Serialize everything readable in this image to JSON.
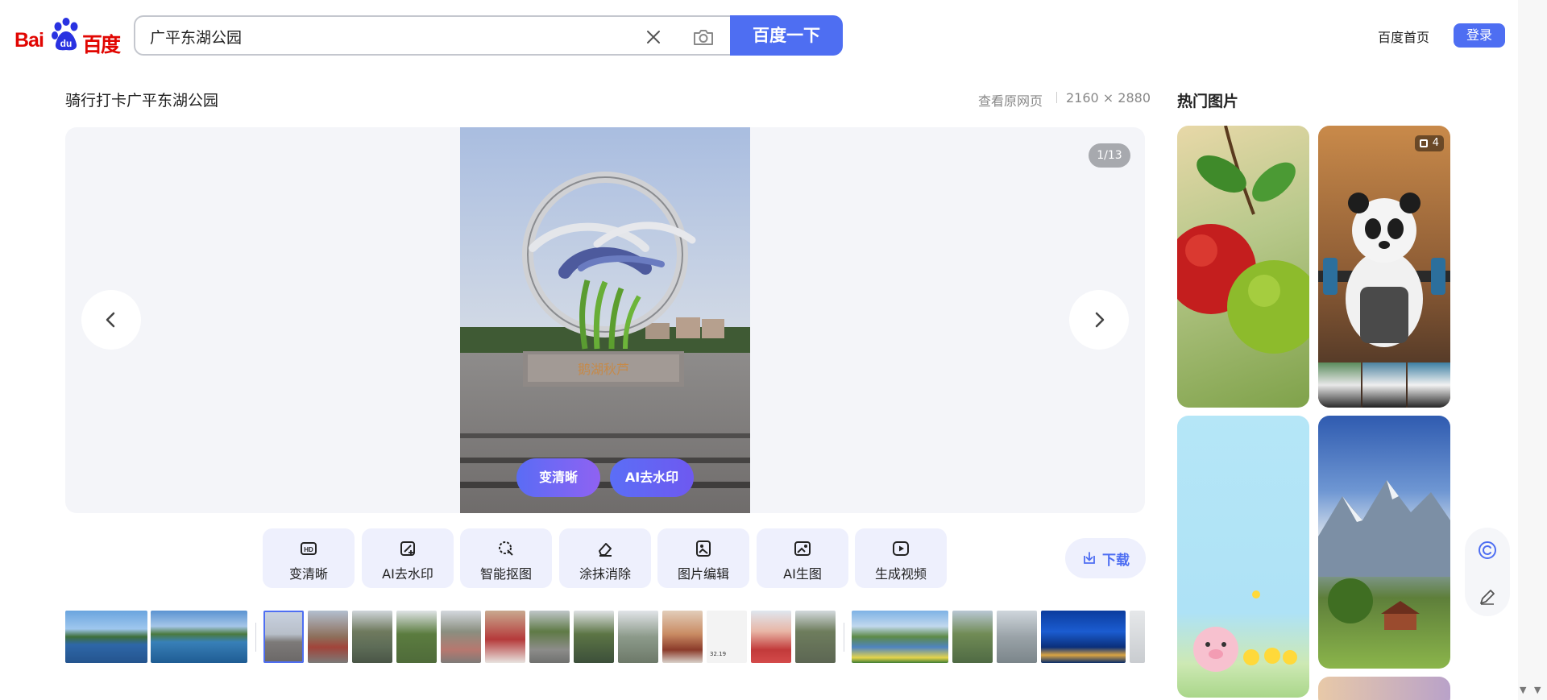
{
  "header": {
    "logo_bai": "Bai",
    "logo_du": "du",
    "logo_cn": "百度",
    "search_value": "广平东湖公园",
    "search_button": "百度一下",
    "home_link": "百度首页",
    "login": "登录"
  },
  "detail": {
    "title": "骑行打卡广平东湖公园",
    "view_original": "查看原网页",
    "dimensions": "2160 × 2880",
    "counter": "1/13",
    "pill_clarify": "变清晰",
    "pill_watermark": "AI去水印",
    "sculpture_inscription": "鹅湖秋芦"
  },
  "tools": [
    {
      "label": "变清晰",
      "icon": "hd-icon"
    },
    {
      "label": "AI去水印",
      "icon": "ai-watermark-icon"
    },
    {
      "label": "智能抠图",
      "icon": "smart-cutout-icon"
    },
    {
      "label": "涂抹消除",
      "icon": "eraser-icon"
    },
    {
      "label": "图片编辑",
      "icon": "image-edit-icon"
    },
    {
      "label": "AI生图",
      "icon": "ai-image-icon"
    },
    {
      "label": "生成视频",
      "icon": "video-generate-icon"
    }
  ],
  "download": "下载",
  "filmstrip": {
    "item11_caption": "32.19"
  },
  "hot": {
    "title": "热门图片",
    "panda_badge": "4"
  },
  "colors": {
    "brand_blue": "#4e6ef2",
    "baidu_red": "#e10602",
    "viewer_bg": "#f4f5f9"
  }
}
